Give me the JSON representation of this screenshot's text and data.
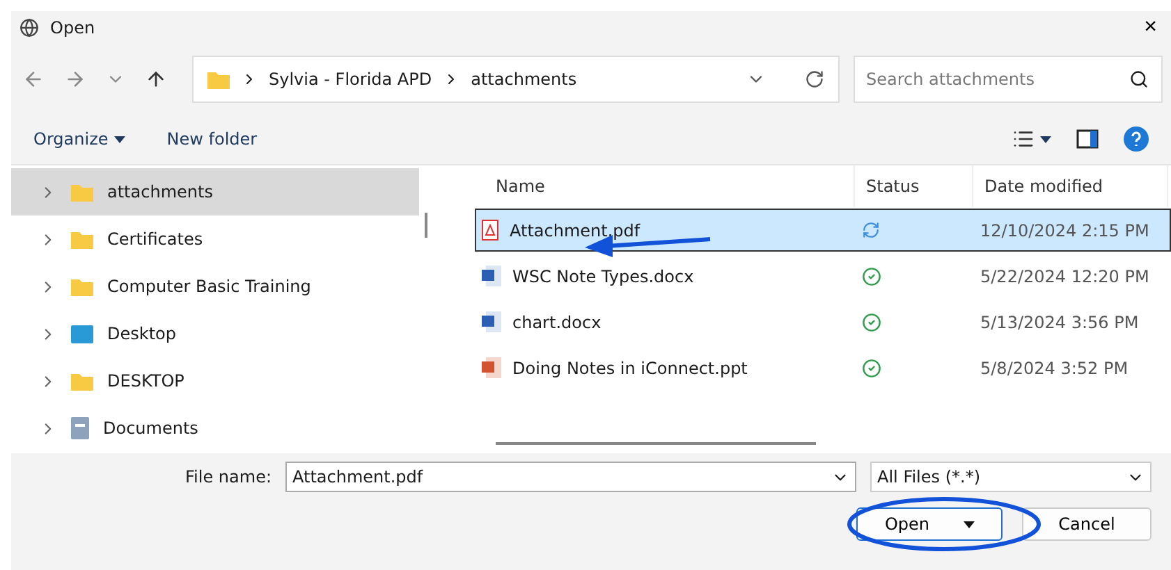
{
  "window": {
    "title": "Open",
    "close": "×"
  },
  "address": {
    "path": [
      "Sylvia - Florida APD",
      "attachments"
    ]
  },
  "search": {
    "placeholder": "Search attachments"
  },
  "toolbar": {
    "organize": "Organize",
    "new_folder": "New folder"
  },
  "sidebar": {
    "items": [
      {
        "label": "attachments",
        "kind": "folder",
        "selected": true
      },
      {
        "label": "Certificates",
        "kind": "folder",
        "selected": false
      },
      {
        "label": "Computer Basic Training",
        "kind": "folder",
        "selected": false
      },
      {
        "label": "Desktop",
        "kind": "desktop",
        "selected": false
      },
      {
        "label": "DESKTOP",
        "kind": "folder",
        "selected": false
      },
      {
        "label": "Documents",
        "kind": "documents",
        "selected": false
      }
    ]
  },
  "table": {
    "columns": [
      "Name",
      "Status",
      "Date modified"
    ],
    "rows": [
      {
        "name": "Attachment.pdf",
        "kind": "pdf",
        "syncing": true,
        "date": "12/10/2024 2:15 PM",
        "selected": true
      },
      {
        "name": "WSC Note Types.docx",
        "kind": "word",
        "syncing": false,
        "date": "5/22/2024 12:20 PM",
        "selected": false
      },
      {
        "name": "chart.docx",
        "kind": "word",
        "syncing": false,
        "date": "5/13/2024 3:56 PM",
        "selected": false
      },
      {
        "name": "Doing Notes in iConnect.ppt",
        "kind": "ppt",
        "syncing": false,
        "date": "5/8/2024 3:52 PM",
        "selected": false
      }
    ]
  },
  "footer": {
    "file_name_label": "File name:",
    "file_name": "Attachment.pdf",
    "filter": "All Files (*.*)",
    "open": "Open",
    "cancel": "Cancel"
  }
}
